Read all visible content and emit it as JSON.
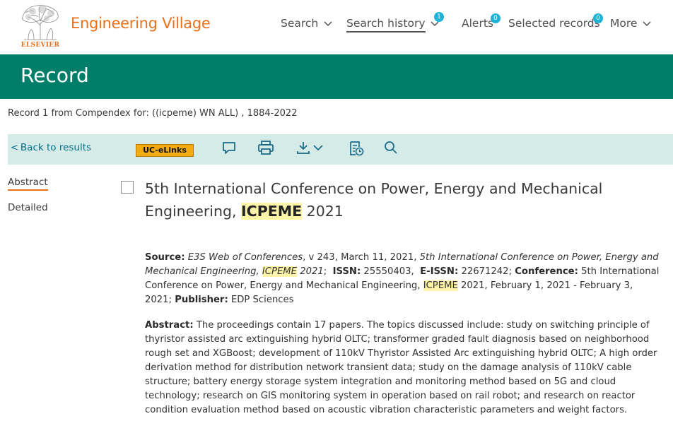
{
  "header": {
    "logo_text": "ELSEVIER",
    "brand": "Engineering Village",
    "nav": {
      "search": "Search",
      "history": "Search history",
      "history_badge": "1",
      "alerts": "Alerts",
      "alerts_badge": "0",
      "selected": "Selected records",
      "selected_badge": "0",
      "more": "More"
    }
  },
  "band_title": "Record",
  "record_line": "Record 1 from Compendex for: ((icpeme) WN ALL) , 1884-2022",
  "toolbar": {
    "back": "Back to results",
    "uc_elinks": "UC-eLinks",
    "icons": [
      "comment-icon",
      "print-icon",
      "download-icon",
      "cite-icon",
      "search-icon"
    ]
  },
  "tabs": {
    "abstract": "Abstract",
    "detailed": "Detailed"
  },
  "record": {
    "title_pre": "5th International Conference on Power, Energy and Mechanical Engineering, ",
    "title_hl": "ICPEME",
    "title_post": " 2021",
    "source_label": "Source:",
    "source_journal": "E3S Web of Conferences",
    "source_vol": ", v 243, March 11, 2021, ",
    "source_conf_italic": "5th International Conference on Power, Energy and Mechanical Engineering, ",
    "source_conf_hl": "ICPEME",
    "source_conf_year": " 2021",
    "issn_label": "ISSN:",
    "issn": "25550403",
    "eissn_label": "E-ISSN:",
    "eissn": "22671242",
    "conference_label": "Conference:",
    "conference_pre": "5th International Conference on Power, Energy and Mechanical Engineering, ",
    "conference_hl": "ICPEME",
    "conference_post": " 2021, February 1, 2021 - February 3, 2021;",
    "publisher_label": "Publisher:",
    "publisher": "EDP Sciences",
    "abstract_label": "Abstract:",
    "abstract": "The proceedings contain 17 papers. The topics discussed include: study on switching principle of thyristor assisted arc extinguishing hybrid OLTC; transformer graded fault diagnosis based on neighborhood rough set and XGBoost; development of 110kV Thyristor Assisted Arc extinguishing hybrid OLTC; A high order derivation method for distribution network transient data; study on the damage analysis of 110kV cable structure; battery energy storage system integration and monitoring method based on 5G and cloud technology; research on GIS monitoring system in operation based on rail robot; and research on reactor condition evaluation method based on acoustic vibration characteristic parameters and weight factors."
  },
  "colors": {
    "brand_orange": "#e9711c",
    "teal_band": "#007e69",
    "toolbar_bg": "#d5ebe8",
    "badge": "#1eb3d6",
    "highlight": "#fff4a8",
    "link": "#00708a"
  }
}
